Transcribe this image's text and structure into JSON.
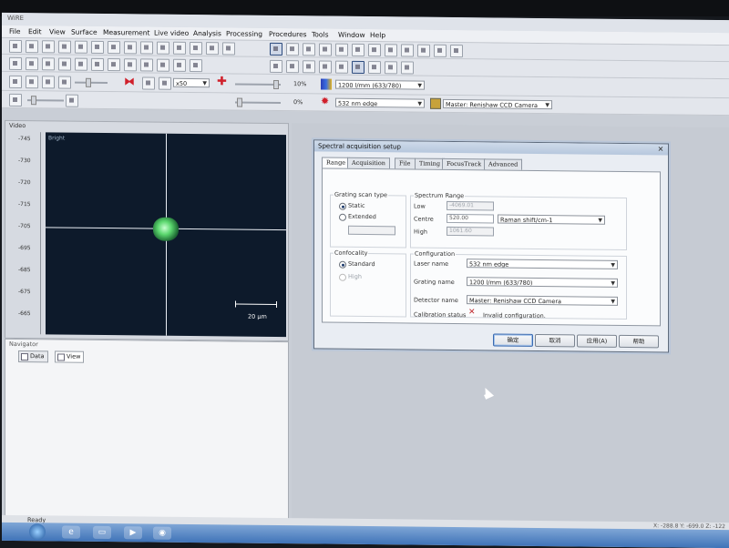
{
  "window": {
    "title": "WiRE"
  },
  "menu": [
    "File",
    "Edit",
    "View",
    "Surface",
    "Measurement",
    "Live video",
    "Analysis",
    "Processing",
    "Procedures",
    "Tools",
    "Window",
    "Help"
  ],
  "toolbar": {
    "zoom_combo": "x50",
    "laser_power": "10%",
    "power2": "0%",
    "grating_combo": "1200 l/mm (633/780)",
    "laser_combo": "532 nm edge",
    "detector_combo": "Master: Renishaw CCD Camera"
  },
  "video_panel": {
    "title": "Video",
    "lut_label": "Bright",
    "y_ticks": [
      "-745",
      "-730",
      "-720",
      "-715",
      "-705",
      "-695",
      "-685",
      "-675",
      "-665"
    ],
    "scale_label": "20 µm"
  },
  "navigator": {
    "title": "Navigator",
    "tabs": [
      "Data",
      "View"
    ]
  },
  "dialog": {
    "title": "Spectral acquisition setup",
    "close_glyph": "✕",
    "tabs": [
      "Range",
      "Acquisition",
      "File",
      "Timing",
      "FocusTrack",
      "Advanced"
    ],
    "grating_scan_type": {
      "label": "Grating scan type",
      "options": [
        "Static",
        "Extended"
      ],
      "selected": "Static"
    },
    "confocality": {
      "label": "Confocality",
      "options": [
        "Standard",
        "High"
      ],
      "selected": "Standard"
    },
    "spectrum_range": {
      "label": "Spectrum Range",
      "low_label": "Low",
      "low_value": "-4069.01",
      "centre_label": "Centre",
      "centre_value": "520.00",
      "units": "Raman shift/cm-1",
      "high_label": "High",
      "high_value": "1061.60"
    },
    "configuration": {
      "label": "Configuration",
      "laser_label": "Laser name",
      "laser_value": "532 nm edge",
      "grating_label": "Grating name",
      "grating_value": "1200 l/mm (633/780)",
      "detector_label": "Detector name",
      "detector_value": "Master: Renishaw CCD Camera",
      "calibration_label": "Calibration status",
      "calibration_value": "Invalid configuration."
    },
    "buttons": [
      "确定",
      "取消",
      "应用(A)",
      "帮助"
    ]
  },
  "status": {
    "left": "Ready",
    "right": "X: -288.8 Y: -699.0 Z: -122"
  }
}
